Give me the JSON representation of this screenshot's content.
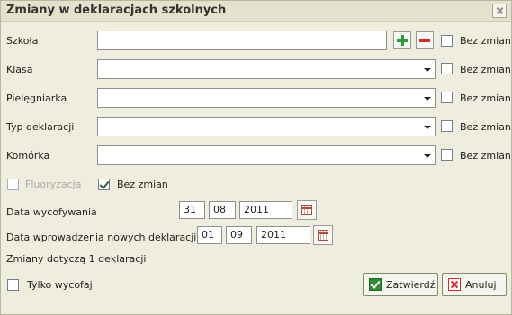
{
  "window": {
    "title": "Zmiany w deklaracjach szkolnych"
  },
  "rows": [
    {
      "label": "Szkoła",
      "value": "",
      "bez_zmian": "Bez zmian"
    },
    {
      "label": "Klasa",
      "value": "",
      "bez_zmian": "Bez zmian"
    },
    {
      "label": "Pielęgniarka",
      "value": "",
      "bez_zmian": "Bez zmian"
    },
    {
      "label": "Typ deklaracji",
      "value": "",
      "bez_zmian": "Bez zmian"
    },
    {
      "label": "Komórka",
      "value": "",
      "bez_zmian": "Bez zmian"
    }
  ],
  "fluoryzacja": {
    "label": "Fluoryzacja",
    "checked": false,
    "disabled": true
  },
  "bez_zmian_fluor": {
    "label": "Bez zmian",
    "checked": true
  },
  "data_wycofywania": {
    "label": "Data wycofywania",
    "day": "31",
    "month": "08",
    "year": "2011"
  },
  "data_wprowadzenia": {
    "label": "Data wprowadzenia nowych deklaracji",
    "day": "01",
    "month": "09",
    "year": "2011"
  },
  "info": "Zmiany dotyczą 1 deklaracji",
  "tylko_wycofaj": {
    "label": "Tylko wycofaj",
    "checked": false
  },
  "buttons": {
    "ok": "Zatwierdź",
    "cancel": "Anuluj"
  }
}
